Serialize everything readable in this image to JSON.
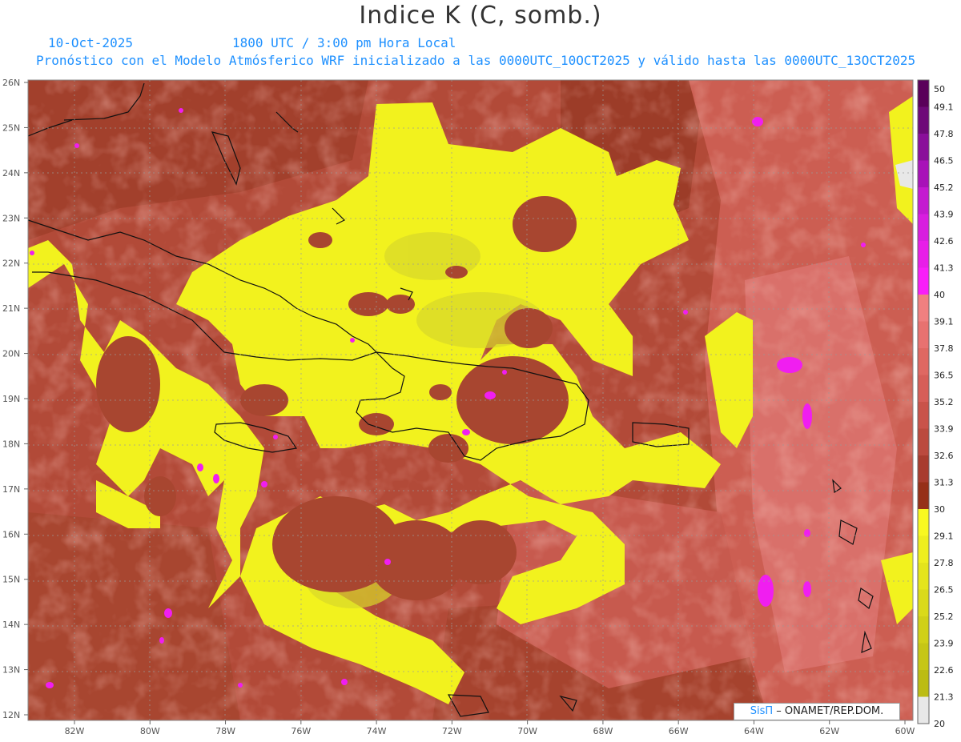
{
  "title": "Indice K (C, somb.)",
  "header": {
    "date": "10-Oct-2025",
    "time": "1800 UTC / 3:00 pm Hora Local",
    "forecast": "Pronóstico con el Modelo Atmósferico WRF inicializado a las 0000UTC_10OCT2025 y válido hasta las  0000UTC_13OCT2025"
  },
  "axes": {
    "lat_labels": [
      "26N",
      "25N",
      "24N",
      "23N",
      "22N",
      "21N",
      "20N",
      "19N",
      "18N",
      "17N",
      "16N",
      "15N",
      "14N",
      "13N",
      "12N"
    ],
    "lon_labels": [
      "82W",
      "80W",
      "78W",
      "76W",
      "74W",
      "72W",
      "70W",
      "68W",
      "66W",
      "64W",
      "62W",
      "60W"
    ]
  },
  "colorbar": {
    "labels": [
      "50",
      "49.1",
      "47.8",
      "46.5",
      "45.2",
      "43.9",
      "42.6",
      "41.3",
      "40",
      "39.1",
      "37.8",
      "36.5",
      "35.2",
      "33.9",
      "32.6",
      "31.3",
      "30",
      "29.1",
      "27.8",
      "26.5",
      "25.2",
      "23.9",
      "22.6",
      "21.3",
      "20"
    ],
    "colors": [
      "#5a005a",
      "#6e0a78",
      "#8a109a",
      "#a812b8",
      "#c41ad0",
      "#d81edf",
      "#e81ee8",
      "#f81ef8",
      "#f08080",
      "#e87270",
      "#df6862",
      "#d65e58",
      "#c9534a",
      "#bb4a3e",
      "#a83c2e",
      "#963018",
      "#f8f820",
      "#eeee1e",
      "#e4e41c",
      "#dada1a",
      "#d0d018",
      "#c6c616",
      "#bcbc14",
      "#e8e8e8"
    ]
  },
  "colors": {
    "field_low": "#9a3a22",
    "field_mid": "#c75a4e",
    "field_high": "#e07a6e",
    "yellow": "#f2f21e",
    "yellow_dark": "#d8d82a",
    "magenta": "#f01ef0"
  },
  "credit": {
    "brand": "SisΠ",
    "org": "– ONAMET/REP.DOM."
  }
}
